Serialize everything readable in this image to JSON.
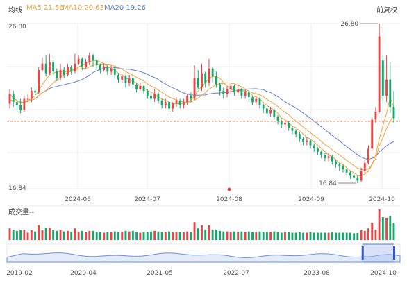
{
  "header": {
    "line_label": "均线",
    "ma5": {
      "label": "MA5 21.56",
      "color": "#f2a23a"
    },
    "ma10": {
      "label": "MA10 20.63",
      "color": "#f2a23a"
    },
    "ma20": {
      "label": "MA20 19.26",
      "color": "#5c7fd6"
    },
    "adjust_button": "前复权"
  },
  "colors": {
    "up": "#e84545",
    "down": "#13a86a",
    "ma5": "#f2a23a",
    "ma10": "#f2a23a",
    "ma20": "#5c7fd6",
    "current_price_line": "#e0622a"
  },
  "volume_panel": {
    "label": "成交量--"
  },
  "navigator": {
    "ticks": [
      "2019-02",
      "2020-04",
      "2021-05",
      "2022-07",
      "2023-08",
      "2024-10"
    ],
    "selection_fraction": [
      0.905,
      0.985
    ]
  },
  "chart_data": {
    "type": "candlestick",
    "y_axis_labels": {
      "max": "26.80",
      "min": "16.84"
    },
    "ylim": [
      16.84,
      26.8
    ],
    "x_ticks": [
      "2024-06",
      "2024-07",
      "2024-08",
      "2024-09",
      "2024-10"
    ],
    "annotations": {
      "high": {
        "label": "26.80",
        "value": 26.8
      },
      "low": {
        "label": "16.84",
        "value": 16.84
      }
    },
    "current_price": 20.7,
    "candles": [
      [
        21.8,
        22.4,
        22.7,
        21.5
      ],
      [
        22.4,
        21.9,
        22.6,
        21.6
      ],
      [
        21.9,
        21.7,
        22.1,
        21.3
      ],
      [
        21.7,
        21.4,
        22.1,
        21.2
      ],
      [
        21.4,
        22.1,
        22.3,
        21.3
      ],
      [
        22.1,
        22.1,
        22.4,
        21.9
      ],
      [
        22.1,
        22.6,
        22.8,
        21.9
      ],
      [
        22.6,
        22.5,
        22.9,
        22.2
      ],
      [
        22.5,
        23.9,
        24.1,
        22.4
      ],
      [
        23.9,
        24.3,
        24.7,
        23.8
      ],
      [
        24.3,
        23.7,
        24.8,
        23.5
      ],
      [
        23.7,
        24.4,
        24.9,
        23.6
      ],
      [
        24.4,
        23.8,
        24.5,
        23.5
      ],
      [
        23.8,
        23.4,
        24.0,
        23.2
      ],
      [
        23.4,
        23.9,
        24.3,
        23.3
      ],
      [
        23.9,
        23.6,
        24.1,
        23.4
      ],
      [
        23.6,
        24.1,
        24.3,
        23.5
      ],
      [
        24.1,
        23.8,
        24.2,
        23.6
      ],
      [
        23.8,
        24.3,
        24.9,
        23.7
      ],
      [
        24.3,
        24.6,
        24.8,
        24.2
      ],
      [
        24.6,
        24.1,
        24.7,
        23.9
      ],
      [
        24.1,
        24.4,
        24.6,
        24.0
      ],
      [
        24.4,
        24.8,
        25.0,
        24.2
      ],
      [
        24.8,
        24.5,
        24.9,
        24.1
      ],
      [
        24.5,
        24.2,
        24.6,
        24.0
      ],
      [
        24.2,
        23.9,
        24.3,
        23.7
      ],
      [
        23.9,
        24.1,
        24.3,
        23.8
      ],
      [
        24.1,
        23.8,
        24.2,
        23.6
      ],
      [
        23.8,
        24.0,
        24.2,
        23.6
      ],
      [
        24.0,
        23.6,
        24.1,
        23.4
      ],
      [
        23.6,
        23.3,
        23.7,
        23.1
      ],
      [
        23.3,
        23.5,
        23.7,
        23.1
      ],
      [
        23.5,
        23.1,
        23.6,
        22.8
      ],
      [
        23.1,
        23.4,
        23.6,
        22.9
      ],
      [
        23.4,
        23.0,
        23.5,
        22.7
      ],
      [
        23.0,
        22.7,
        23.1,
        22.5
      ],
      [
        22.7,
        22.9,
        23.1,
        22.6
      ],
      [
        22.9,
        22.6,
        23.0,
        22.4
      ],
      [
        22.6,
        22.3,
        22.7,
        22.1
      ],
      [
        22.3,
        22.1,
        22.5,
        21.8
      ],
      [
        22.1,
        22.4,
        22.7,
        21.9
      ],
      [
        22.4,
        22.0,
        22.5,
        21.8
      ],
      [
        22.0,
        21.7,
        22.1,
        21.5
      ],
      [
        21.7,
        21.9,
        22.1,
        21.5
      ],
      [
        21.9,
        21.5,
        22.0,
        21.3
      ],
      [
        21.5,
        21.8,
        21.9,
        21.3
      ],
      [
        21.8,
        22.0,
        22.2,
        21.6
      ],
      [
        22.0,
        21.7,
        22.1,
        21.5
      ],
      [
        21.7,
        21.9,
        22.1,
        21.5
      ],
      [
        21.9,
        22.3,
        22.4,
        21.7
      ],
      [
        22.3,
        22.1,
        22.5,
        21.9
      ],
      [
        22.1,
        23.4,
        24.2,
        22.0
      ],
      [
        23.4,
        22.8,
        23.9,
        22.7
      ],
      [
        22.8,
        23.7,
        24.3,
        22.6
      ],
      [
        23.7,
        23.1,
        23.8,
        22.8
      ],
      [
        23.1,
        24.0,
        24.6,
        22.9
      ],
      [
        24.0,
        23.5,
        24.1,
        23.1
      ],
      [
        23.5,
        23.0,
        23.8,
        22.8
      ],
      [
        23.0,
        22.6,
        23.1,
        22.3
      ],
      [
        22.6,
        22.4,
        22.8,
        22.1
      ],
      [
        22.4,
        22.7,
        22.9,
        22.2
      ],
      [
        22.7,
        22.9,
        23.0,
        22.4
      ],
      [
        22.9,
        22.5,
        23.0,
        22.3
      ],
      [
        22.5,
        22.7,
        22.9,
        22.3
      ],
      [
        22.7,
        22.3,
        22.8,
        22.1
      ],
      [
        22.3,
        22.5,
        22.7,
        22.1
      ],
      [
        22.5,
        22.2,
        22.6,
        21.9
      ],
      [
        22.2,
        21.9,
        22.3,
        21.7
      ],
      [
        21.9,
        22.1,
        22.3,
        21.7
      ],
      [
        22.1,
        21.7,
        22.2,
        21.5
      ],
      [
        21.7,
        21.5,
        21.8,
        21.2
      ],
      [
        21.5,
        21.2,
        21.6,
        21.0
      ],
      [
        21.2,
        21.4,
        21.6,
        21.0
      ],
      [
        21.4,
        21.0,
        21.5,
        20.8
      ],
      [
        21.0,
        20.7,
        21.1,
        20.5
      ],
      [
        20.7,
        20.5,
        20.8,
        20.3
      ],
      [
        20.5,
        20.6,
        20.8,
        20.2
      ],
      [
        20.6,
        20.3,
        20.7,
        20.1
      ],
      [
        20.3,
        20.1,
        20.4,
        19.9
      ],
      [
        20.1,
        19.9,
        20.2,
        19.7
      ],
      [
        19.9,
        19.6,
        20.0,
        19.4
      ],
      [
        19.6,
        19.4,
        19.7,
        19.2
      ],
      [
        19.4,
        19.5,
        19.7,
        19.2
      ],
      [
        19.5,
        19.2,
        19.6,
        19.0
      ],
      [
        19.2,
        19.0,
        19.3,
        18.8
      ],
      [
        19.0,
        18.8,
        19.1,
        18.6
      ],
      [
        18.8,
        18.6,
        18.9,
        18.4
      ],
      [
        18.6,
        18.4,
        18.7,
        18.2
      ],
      [
        18.4,
        18.5,
        18.7,
        18.2
      ],
      [
        18.5,
        18.2,
        18.6,
        18.0
      ],
      [
        18.2,
        18.0,
        18.3,
        17.8
      ],
      [
        18.0,
        17.9,
        18.1,
        17.6
      ],
      [
        17.9,
        17.7,
        18.0,
        17.5
      ],
      [
        17.7,
        17.5,
        17.8,
        17.3
      ],
      [
        17.5,
        17.3,
        17.6,
        17.1
      ],
      [
        17.3,
        17.2,
        17.4,
        17.0
      ],
      [
        17.2,
        17.0,
        17.3,
        16.84
      ],
      [
        17.0,
        17.6,
        17.8,
        16.9
      ],
      [
        17.6,
        18.1,
        18.3,
        17.5
      ],
      [
        18.1,
        19.0,
        19.2,
        18.0
      ],
      [
        19.0,
        20.8,
        21.0,
        18.9
      ],
      [
        20.8,
        21.3,
        21.6,
        20.6
      ],
      [
        21.3,
        26.0,
        26.8,
        21.2
      ],
      [
        24.5,
        22.3,
        24.8,
        21.8
      ],
      [
        22.3,
        23.3,
        24.8,
        21.9
      ],
      [
        23.3,
        21.6,
        24.4,
        21.2
      ],
      [
        21.6,
        20.9,
        22.6,
        20.6
      ]
    ],
    "ma5": [
      22.0,
      22.0,
      21.95,
      21.9,
      21.9,
      22.0,
      22.1,
      22.3,
      22.6,
      23.0,
      23.3,
      23.6,
      23.7,
      23.8,
      23.8,
      23.8,
      23.8,
      23.8,
      23.9,
      24.1,
      24.2,
      24.3,
      24.4,
      24.5,
      24.5,
      24.4,
      24.3,
      24.1,
      24.0,
      23.9,
      23.7,
      23.6,
      23.4,
      23.3,
      23.2,
      23.1,
      22.9,
      22.8,
      22.6,
      22.5,
      22.4,
      22.2,
      22.1,
      22.0,
      21.9,
      21.8,
      21.8,
      21.8,
      21.8,
      21.9,
      22.0,
      22.3,
      22.6,
      22.9,
      23.1,
      23.4,
      23.5,
      23.5,
      23.4,
      23.1,
      22.9,
      22.7,
      22.6,
      22.6,
      22.6,
      22.6,
      22.5,
      22.3,
      22.2,
      22.1,
      21.9,
      21.7,
      21.5,
      21.4,
      21.2,
      20.9,
      20.8,
      20.6,
      20.4,
      20.3,
      20.1,
      19.9,
      19.7,
      19.6,
      19.4,
      19.2,
      19.0,
      18.8,
      18.6,
      18.5,
      18.3,
      18.1,
      18.0,
      17.8,
      17.6,
      17.5,
      17.3,
      17.3,
      17.4,
      17.6,
      18.0,
      18.6,
      19.6,
      20.4,
      21.2,
      22.2,
      21.56
    ]
  }
}
